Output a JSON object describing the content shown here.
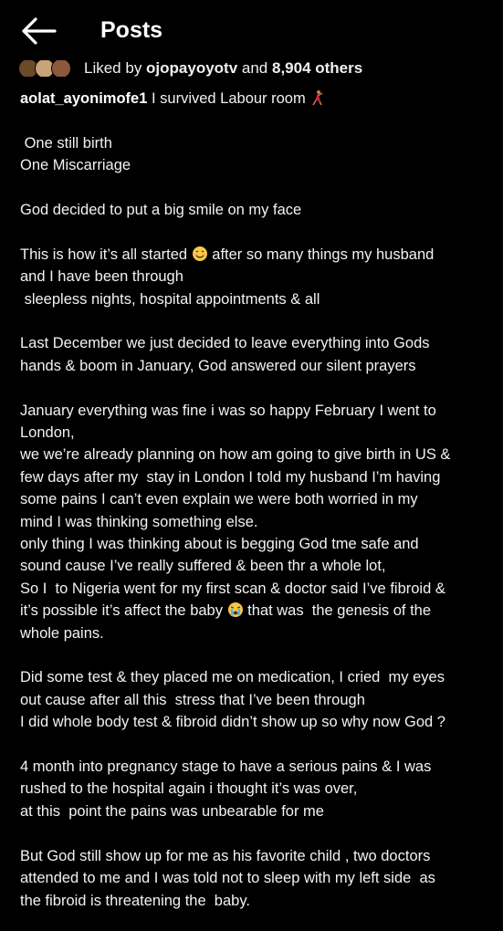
{
  "header": {
    "title": "Posts",
    "back_icon": "arrow-left-icon"
  },
  "likes": {
    "prefix": "Liked by ",
    "username": "ojopayoyotv",
    "middle": " and ",
    "count": "8,904",
    "suffix": " others",
    "avatar_colors": [
      "#6b4a2a",
      "#c9a37a",
      "#8a5a3a"
    ]
  },
  "post": {
    "username": "aolat_ayonimofe1",
    "first_line_text": " I survived Labour room ",
    "first_line_emoji": "dancer-emoji",
    "lines": [
      "",
      " One still birth",
      "One Miscarriage",
      "",
      "God decided to put a big smile on my face",
      "",
      "This is how it’s all started ",
      "and I have been through",
      " sleepless nights, hospital appointments & all",
      "",
      "Last December we just decided to leave everything into Gods",
      "hands & boom in January, God answered our silent prayers",
      "",
      "January everything was fine i was so happy February I went to",
      "London,",
      "we we’re already planning on how am going to give birth in US &",
      "few days after my  stay in London I told my husband I’m having",
      "some pains I can’t even explain we were both worried in my",
      "mind I was thinking something else.",
      "only thing I was thinking about is begging God tme safe and",
      "sound cause I’ve really suffered & been thr a whole lot,",
      "So I  to Nigeria went for my first scan & doctor said I’ve fibroid &",
      "it’s possible it’s affect the baby ",
      "whole pains.",
      "",
      "Did some test & they placed me on medication, I cried  my eyes",
      "out cause after all this  stress that I’ve been through",
      "I did whole body test & fibroid didn’t show up so why now God ?",
      "",
      "4 month into pregnancy stage to have a serious pains & I was",
      "rushed to the hospital again i thought it’s was over,",
      "at this  point the pains was unbearable for me",
      "",
      "But God still show up for me as his favorite child , two doctors",
      "attended to me and I was told not to sleep with my left side  as",
      "the fibroid is threatening the  baby."
    ],
    "line7_after_emoji": " after so many things my husband",
    "line7_emoji": "smiling-face-emoji",
    "line23_after_emoji": " that was  the genesis of the",
    "line23_emoji": "crying-face-emoji"
  }
}
